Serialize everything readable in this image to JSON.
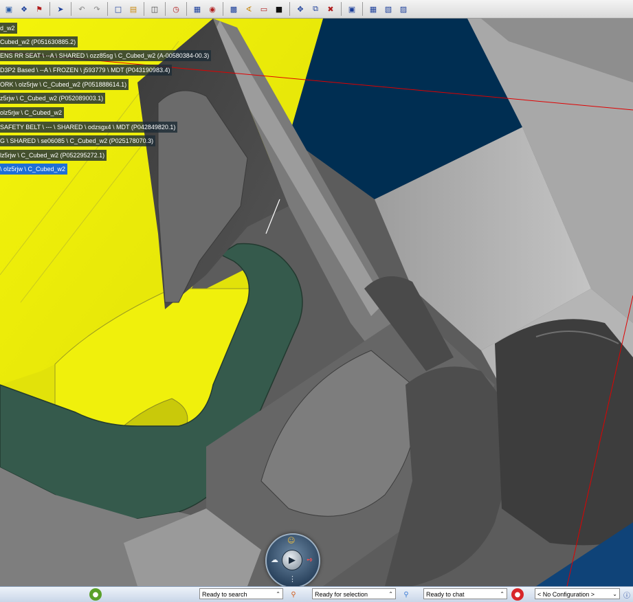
{
  "toolbar": {
    "icons": [
      "bin-icon",
      "tree-icon",
      "flag-icon",
      "pointer-icon",
      "undo-icon",
      "redo-icon",
      "select-icon",
      "folder-icon",
      "copy-icon",
      "clock-icon",
      "stack-icon",
      "render-icon",
      "view-icon",
      "measure-icon",
      "sheet-icon",
      "camera-icon",
      "axis-icon",
      "split-icon",
      "delete-icon",
      "window-icon",
      "grid-icon",
      "grid-alt-icon",
      "grid-third-icon"
    ]
  },
  "tree": {
    "items": [
      "d_w2",
      "Cubed_w2 (P051630885.2)",
      "ENS RR SEAT \\ --A \\ SHARED \\ ozz85sg \\ C_Cubed_w2 (A-00580384-00.3)",
      "D3P2 Based \\ --A \\ FROZEN \\ j593779 \\ MDT (P043190983.4)",
      "ORK \\ olz5rjw \\ C_Cubed_w2 (P051888614.1)",
      "z5rjw \\ C_Cubed_w2 (P052089003.1)",
      "olz5rjw \\ C_Cubed_w2",
      "SAFETY BELT \\ --- \\ SHARED \\ odzsgx4 \\ MDT (P042849820.1)",
      "G \\ SHARED \\ se06085 \\ C_Cubed_w2 (P025178070.3)",
      "lz5rjw \\ C_Cubed_w2 (P052295272.1)",
      "\\ olz5rjw \\ C_Cubed_w2"
    ],
    "selected_index": 10
  },
  "compass": {
    "play_icon": "play-icon"
  },
  "status": {
    "search": "Ready to search",
    "selection": "Ready for selection",
    "chat": "Ready to chat",
    "configuration": "< No Configuration >"
  },
  "colors": {
    "toolbar": "#dcdcdc",
    "yellow_part": "#f2f20a",
    "green_part": "#355a4c",
    "background_blue": "#002e52",
    "selected_label": "#1f6fd6",
    "red_line": "#e00000"
  }
}
